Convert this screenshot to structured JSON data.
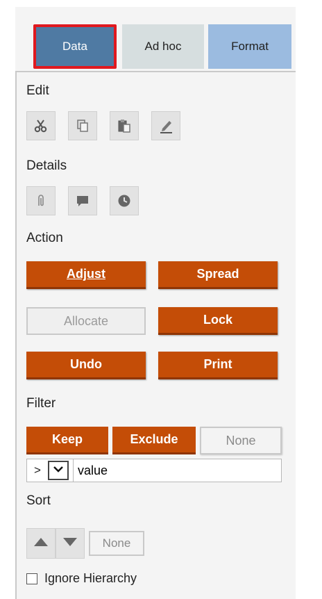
{
  "tabs": [
    {
      "label": "Data",
      "active": true
    },
    {
      "label": "Ad hoc",
      "active": false
    },
    {
      "label": "Format",
      "active": false
    }
  ],
  "edit": {
    "label": "Edit",
    "icons": [
      "scissors-icon",
      "copy-icon",
      "paste-icon",
      "edit-pencil-icon"
    ]
  },
  "details": {
    "label": "Details",
    "icons": [
      "attachment-icon",
      "comment-icon",
      "history-clock-icon"
    ]
  },
  "action": {
    "label": "Action",
    "buttons": [
      {
        "label": "Adjust",
        "enabled": true
      },
      {
        "label": "Spread",
        "enabled": true
      },
      {
        "label": "Allocate",
        "enabled": false
      },
      {
        "label": "Lock",
        "enabled": true
      },
      {
        "label": "Undo",
        "enabled": true
      },
      {
        "label": "Print",
        "enabled": true
      }
    ]
  },
  "filter": {
    "label": "Filter",
    "buttons": [
      "Keep",
      "Exclude",
      "None"
    ],
    "operator": ">",
    "value": "value"
  },
  "sort": {
    "label": "Sort",
    "none_label": "None"
  },
  "ignore_hierarchy": {
    "label": "Ignore Hierarchy",
    "checked": false
  },
  "colors": {
    "accent_orange": "#c44d07",
    "active_tab": "#4f7aa3",
    "highlight_border": "#e0191f"
  }
}
